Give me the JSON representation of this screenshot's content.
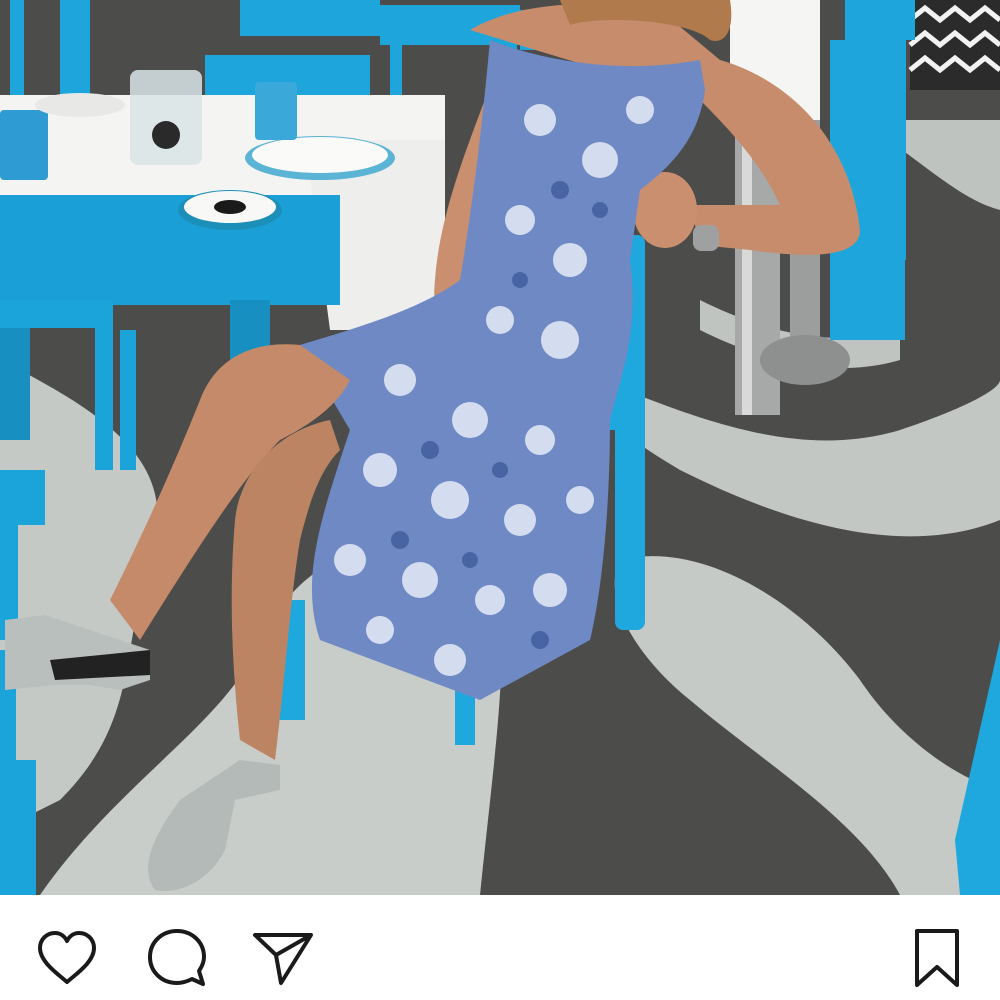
{
  "post": {
    "photo": {
      "alt": "",
      "colors": {
        "floor_dark": "#4a4a48",
        "floor_light": "#c8ccc9",
        "furniture": "#1aa3d8",
        "tablecloth": "#f4f4f2",
        "dress": "#6d87c0",
        "skin": "#c98f6d"
      }
    },
    "actions": {
      "like_icon": "heart-icon",
      "comment_icon": "comment-bubble-icon",
      "share_icon": "paper-plane-icon",
      "save_icon": "bookmark-icon",
      "icon_color": "#1a1a1a"
    }
  }
}
